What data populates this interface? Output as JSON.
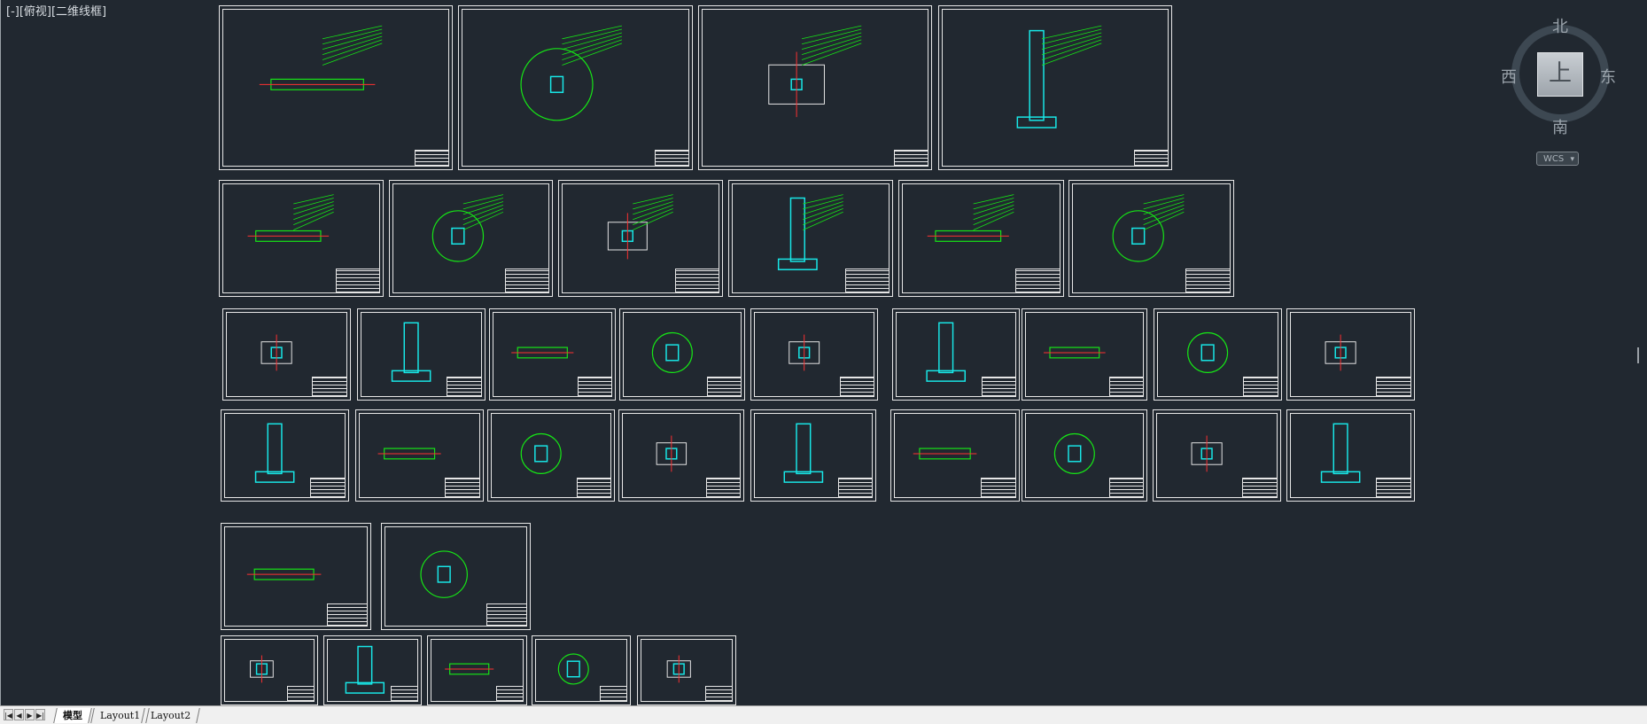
{
  "viewport": {
    "label": "[-][俯视][二维线框]",
    "background": "#212830"
  },
  "viewcube": {
    "top_face": "上",
    "north": "北",
    "south": "南",
    "east": "东",
    "west": "西"
  },
  "wcs": {
    "label": "WCS",
    "chevron": "▾"
  },
  "tabs": [
    {
      "label": "模型",
      "active": true
    },
    {
      "label": "Layout1",
      "active": false
    },
    {
      "label": "Layout2",
      "active": false
    }
  ],
  "nav_buttons": [
    "|◀",
    "◀",
    "▶",
    "▶|"
  ],
  "colors": {
    "green": "#16e616",
    "cyan": "#18e8e8",
    "red": "#ff3030",
    "white": "#e6e6e6",
    "yellow": "#e8e820"
  }
}
